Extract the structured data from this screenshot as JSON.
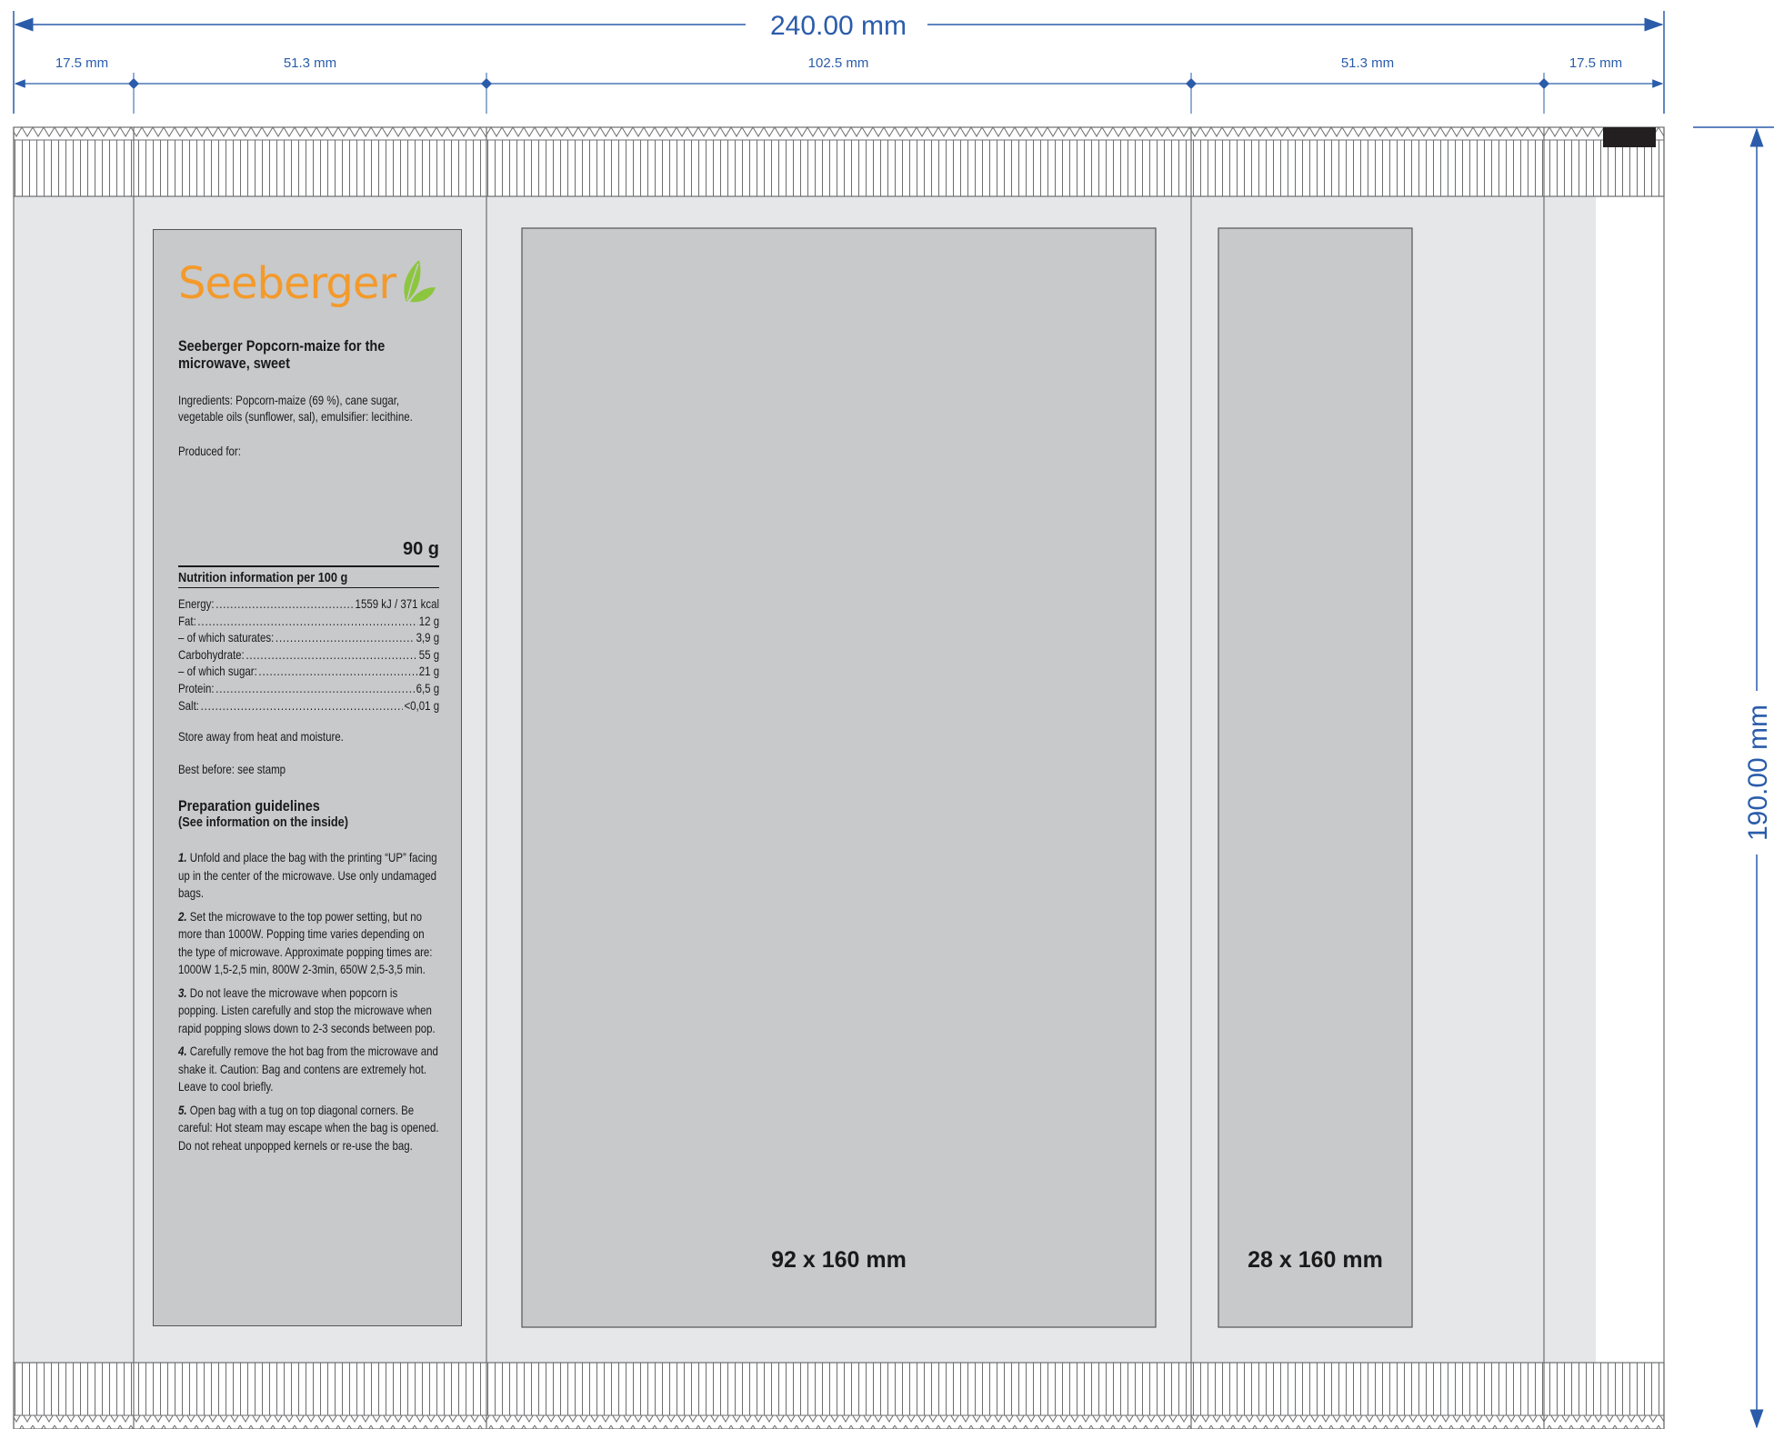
{
  "dimensions": {
    "overall_width": "240.00 mm",
    "overall_height": "190.00 mm",
    "segments": [
      "17.5 mm",
      "51.3 mm",
      "102.5 mm",
      "51.3 mm",
      "17.5 mm"
    ]
  },
  "panels": {
    "front_caption": "92 x 160 mm",
    "side_caption": "28 x 160 mm"
  },
  "label": {
    "brand": "Seeberger",
    "product_title": "Seeberger Popcorn-maize for the microwave, sweet",
    "ingredients": "Ingredients: Popcorn-maize (69 %), cane sugar, vegetable oils (sunflower, sal), emulsifier: lecithine.",
    "produced_for": "Produced for:",
    "weight": "90 g",
    "nutrition_heading": "Nutrition information per 100 g",
    "nutrition": [
      {
        "name": "Energy:",
        "value": "1559 kJ / 371 kcal"
      },
      {
        "name": "Fat:",
        "value": "12 g"
      },
      {
        "name": "– of which saturates:",
        "value": "3,9 g"
      },
      {
        "name": "Carbohydrate:",
        "value": "55 g"
      },
      {
        "name": "– of which sugar:",
        "value": "21 g"
      },
      {
        "name": "Protein:",
        "value": "6,5 g"
      },
      {
        "name": "Salt:",
        "value": "<0,01 g"
      }
    ],
    "storage": "Store away from heat and moisture.",
    "best_before": "Best before: see stamp",
    "prep_title": "Preparation guidelines",
    "prep_subtitle": "(See information on the inside)",
    "steps": [
      {
        "num": "1.",
        "text": "Unfold and place the bag with the printing “UP” facing up in the center of the microwave. Use only undamaged bags."
      },
      {
        "num": "2.",
        "text": "Set the microwave to the top power setting, but no more than 1000W. Popping time varies depending on the type of microwave. Approximate popping times are: 1000W 1,5-2,5 min, 800W 2-3min, 650W 2,5-3,5 min."
      },
      {
        "num": "3.",
        "text": "Do not leave the microwave when popcorn is popping. Listen carefully and stop the microwave when rapid popping slows down to 2-3 seconds between pop."
      },
      {
        "num": "4.",
        "text": "Carefully remove the hot bag from the microwave and shake it. Caution: Bag and contens are extremely hot. Leave to cool briefly."
      },
      {
        "num": "5.",
        "text": "Open bag with a tug on top diagonal corners. Be careful: Hot steam may escape when the bag is opened. Do not reheat unpopped kernels or re-use the bag."
      }
    ]
  },
  "colors": {
    "dimension_blue": "#2a5caa",
    "brand_orange": "#f39a2b",
    "leaf_green": "#8cc63f",
    "panel_gray": "#c8c9cb",
    "background_gray": "#e6e7e8"
  }
}
